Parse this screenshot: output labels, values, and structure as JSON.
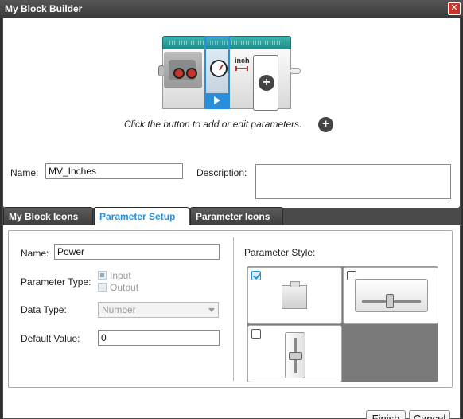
{
  "window": {
    "title": "My Block Builder",
    "close_icon": "close-icon"
  },
  "preview": {
    "hint_text": "Click the button to add or edit parameters.",
    "inch_label": "inch",
    "add_param_icon": "plus-circle-icon"
  },
  "block_info": {
    "name_label": "Name:",
    "name_value": "MV_Inches",
    "description_label": "Description:",
    "description_value": ""
  },
  "tabs": [
    {
      "label": "My Block Icons",
      "active": false
    },
    {
      "label": "Parameter Setup",
      "active": true
    },
    {
      "label": "Parameter Icons",
      "active": false
    }
  ],
  "parameter": {
    "name_label": "Name:",
    "name_value": "Power",
    "type_label": "Parameter Type:",
    "type_options": [
      "Input",
      "Output"
    ],
    "type_selected": "Input",
    "data_type_label": "Data Type:",
    "data_type_value": "Number",
    "default_label": "Default Value:",
    "default_value": "0",
    "style_label": "Parameter Style:",
    "styles": [
      {
        "name": "port",
        "checked": true
      },
      {
        "name": "horizontal-slider",
        "checked": false
      },
      {
        "name": "vertical-slider",
        "checked": false
      }
    ]
  },
  "footer": {
    "finish_label": "Finish",
    "cancel_label": "Cancel"
  },
  "colors": {
    "accent": "#2a8fd8",
    "block_strip": "#1b8b86",
    "motor_red": "#c8352a"
  }
}
